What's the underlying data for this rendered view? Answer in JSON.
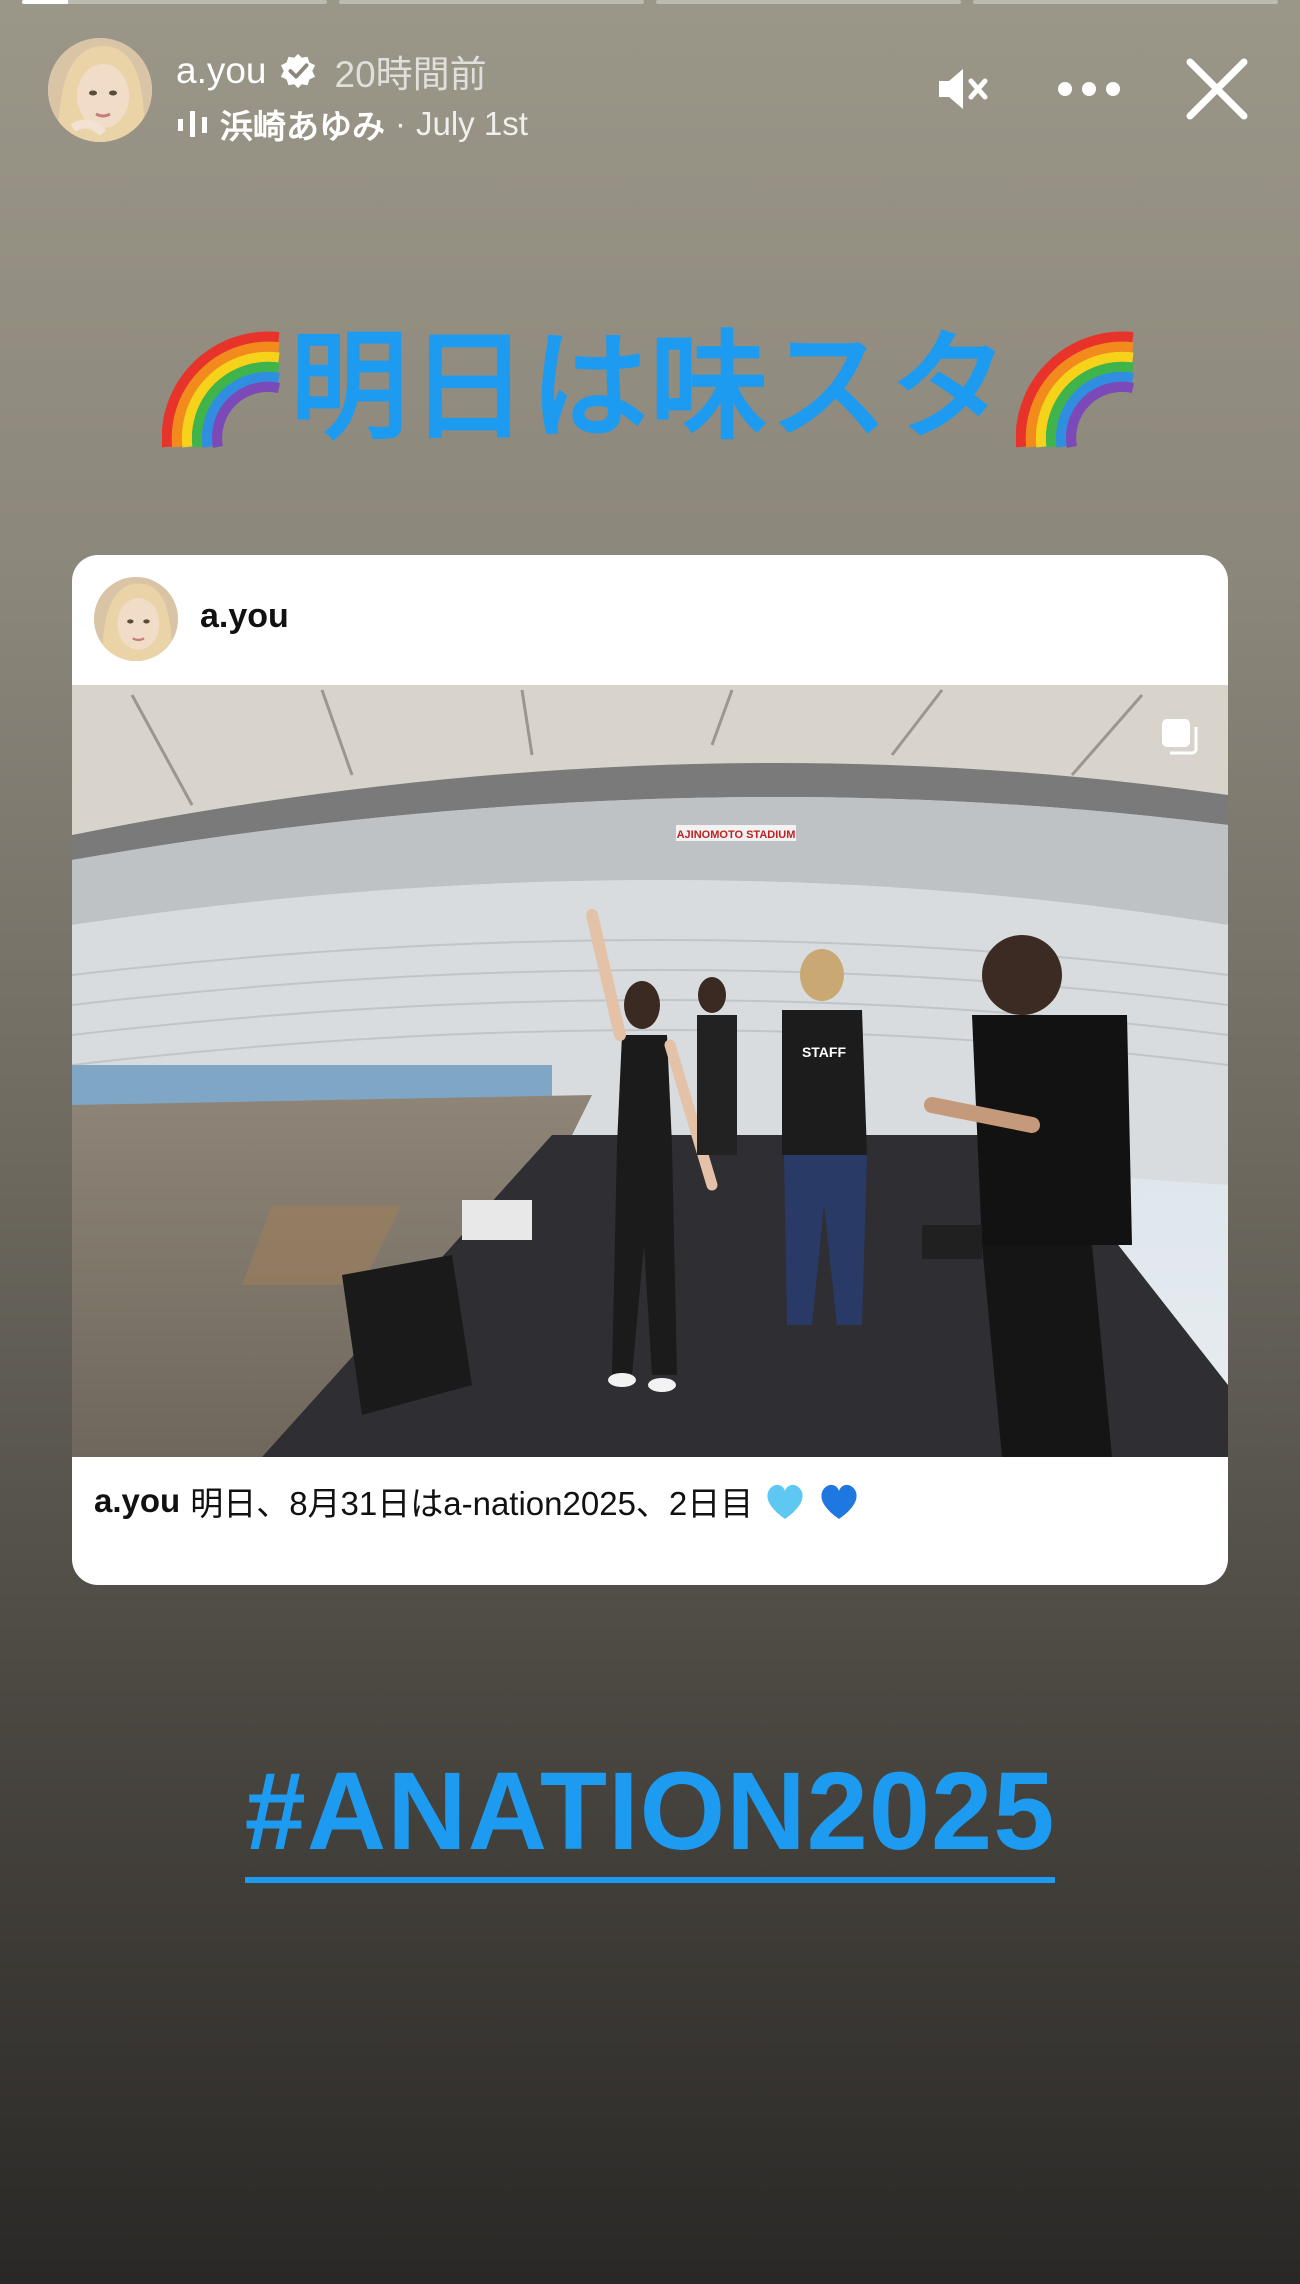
{
  "progress": {
    "segments": 4,
    "current_fraction": 0.15
  },
  "header": {
    "username": "a.you",
    "time_ago": "20時間前",
    "music_artist": "浜崎あゆみ",
    "music_separator": "·",
    "music_date": "July 1st"
  },
  "icons": {
    "verified": "verified-badge-icon",
    "music": "music-bars-icon",
    "mute": "speaker-muted-icon",
    "more": "more-options-icon",
    "close": "close-icon",
    "multi": "multiple-images-icon"
  },
  "headline": {
    "text": "明日は味スタ"
  },
  "card": {
    "username": "a.you",
    "photo_sign": "AJINOMOTO STADIUM",
    "shirt_text": "STAFF",
    "caption_user": "a.you",
    "caption_text": "明日、8月31日はa-nation2025、2日目"
  },
  "hashtag": "#ANATION2025",
  "colors": {
    "accent_blue": "#1d9bf0",
    "heart_light": "#5ec8f2",
    "heart_blue": "#1f78e0"
  }
}
